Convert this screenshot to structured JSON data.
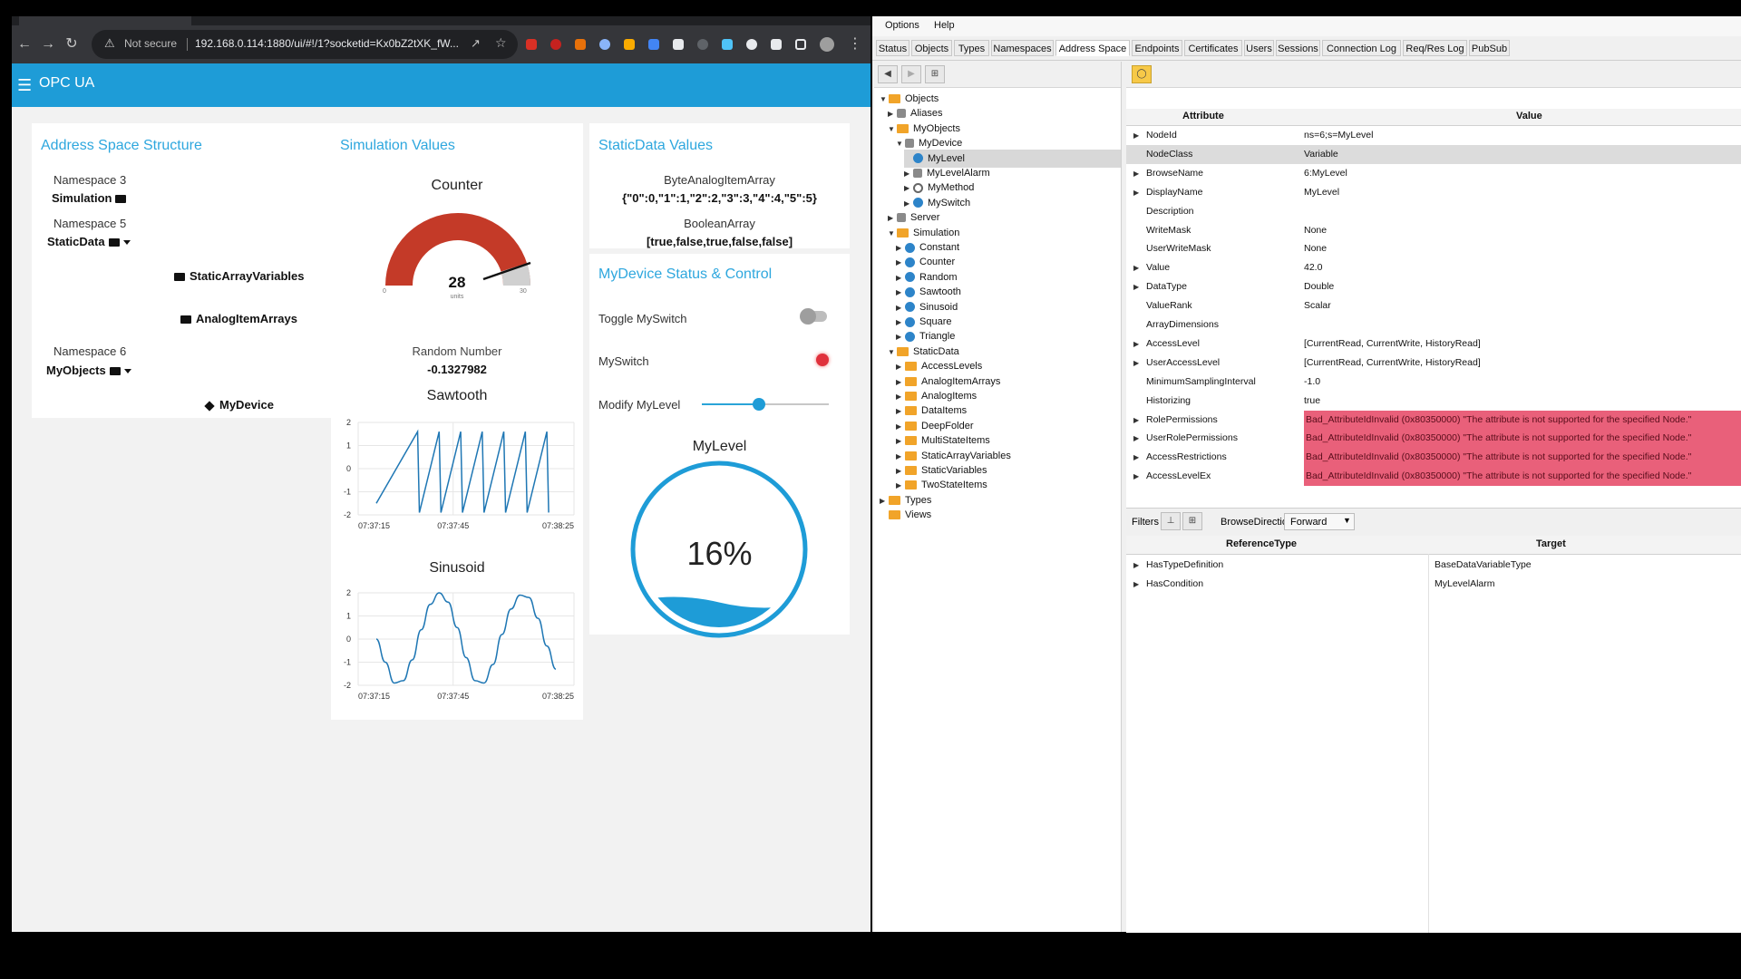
{
  "browser": {
    "security": "Not secure",
    "url": "192.168.0.114:1880/ui/#!/1?socketid=Kx0bZ2tXK_fW..."
  },
  "dashboard": {
    "app_title": "OPC UA",
    "address_space": {
      "title": "Address Space Structure",
      "ns3": "Namespace 3",
      "simulation": "Simulation",
      "ns5": "Namespace 5",
      "staticdata": "StaticData",
      "static_array_variables": "StaticArrayVariables",
      "analog_item_arrays": "AnalogItemArrays",
      "ns6": "Namespace 6",
      "myobjects": "MyObjects",
      "mydevice": "MyDevice"
    },
    "simulation": {
      "title": "Simulation Values",
      "counter_label": "Counter",
      "counter_value": "28",
      "counter_units": "units",
      "counter_min": "0",
      "counter_max": "30",
      "random_label": "Random Number",
      "random_value": "-0.1327982"
    },
    "static_data": {
      "title": "StaticData Values",
      "byte_label": "ByteAnalogItemArray",
      "byte_value": "{\"0\":0,\"1\":1,\"2\":2,\"3\":3,\"4\":4,\"5\":5}",
      "bool_label": "BooleanArray",
      "bool_value": "[true,false,true,false,false]"
    },
    "device": {
      "title": "MyDevice Status & Control",
      "toggle_label": "Toggle MySwitch",
      "switch_label": "MySwitch",
      "modify_label": "Modify MyLevel",
      "slider_fraction": 0.45,
      "mylevel_title": "MyLevel",
      "mylevel_value": "16%",
      "mylevel_fraction": 0.16
    }
  },
  "chart_data": [
    {
      "type": "line",
      "title": "Sawtooth",
      "ylim": [
        -2,
        2
      ],
      "yticks": [
        "2",
        "1",
        "0",
        "-1",
        "-2"
      ],
      "xticks": [
        "07:37:15",
        "07:37:45",
        "07:38:25"
      ],
      "x": [
        0,
        0.23,
        0.24,
        0.35,
        0.36,
        0.47,
        0.48,
        0.59,
        0.6,
        0.71,
        0.72,
        0.83,
        0.84,
        0.95,
        0.96
      ],
      "values": [
        -1.5,
        1.6,
        -1.9,
        1.6,
        -1.9,
        1.6,
        -1.9,
        1.6,
        -1.9,
        1.6,
        -1.9,
        1.6,
        -1.9,
        1.6,
        -1.9
      ]
    },
    {
      "type": "line",
      "title": "Sinusoid",
      "ylim": [
        -2,
        2
      ],
      "yticks": [
        "2",
        "1",
        "0",
        "-1",
        "-2"
      ],
      "xticks": [
        "07:37:15",
        "07:37:45",
        "07:38:25"
      ],
      "x": [
        0,
        0.05,
        0.1,
        0.15,
        0.2,
        0.25,
        0.3,
        0.35,
        0.4,
        0.45,
        0.5,
        0.55,
        0.6,
        0.65,
        0.7,
        0.75,
        0.8,
        0.85,
        0.9,
        0.95,
        1.0
      ],
      "values": [
        0.0,
        -1.0,
        -1.9,
        -1.8,
        -0.9,
        0.4,
        1.5,
        2.0,
        1.6,
        0.5,
        -0.8,
        -1.8,
        -1.9,
        -1.1,
        0.2,
        1.3,
        1.9,
        1.8,
        0.9,
        -0.3,
        -1.3
      ]
    }
  ],
  "app": {
    "menu": [
      "Options",
      "Help"
    ],
    "tabs": [
      "Status",
      "Objects",
      "Types",
      "Namespaces",
      "Address Space",
      "Endpoints",
      "Certificates",
      "Users",
      "Sessions",
      "Connection Log",
      "Req/Res Log",
      "PubSub"
    ],
    "tree": [
      {
        "label": "Objects",
        "icon": "folder",
        "arrow": "▼"
      },
      {
        "label": "Aliases",
        "icon": "object",
        "arrow": "▶"
      },
      {
        "label": "MyObjects",
        "icon": "folder",
        "arrow": "▼"
      },
      {
        "label": "MyDevice",
        "icon": "object",
        "arrow": "▼"
      },
      {
        "label": "MyLevel",
        "icon": "variable",
        "arrow": ""
      },
      {
        "label": "MyLevelAlarm",
        "icon": "object",
        "arrow": "▶"
      },
      {
        "label": "MyMethod",
        "icon": "gear",
        "arrow": "▶"
      },
      {
        "label": "MySwitch",
        "icon": "variable",
        "arrow": "▶"
      },
      {
        "label": "Server",
        "icon": "object",
        "arrow": "▶"
      },
      {
        "label": "Simulation",
        "icon": "folder",
        "arrow": "▼"
      },
      {
        "label": "Constant",
        "icon": "variable",
        "arrow": "▶"
      },
      {
        "label": "Counter",
        "icon": "variable",
        "arrow": "▶"
      },
      {
        "label": "Random",
        "icon": "variable",
        "arrow": "▶"
      },
      {
        "label": "Sawtooth",
        "icon": "variable",
        "arrow": "▶"
      },
      {
        "label": "Sinusoid",
        "icon": "variable",
        "arrow": "▶"
      },
      {
        "label": "Square",
        "icon": "variable",
        "arrow": "▶"
      },
      {
        "label": "Triangle",
        "icon": "variable",
        "arrow": "▶"
      },
      {
        "label": "StaticData",
        "icon": "folder",
        "arrow": "▼"
      },
      {
        "label": "AccessLevels",
        "icon": "folder",
        "arrow": "▶"
      },
      {
        "label": "AnalogItemArrays",
        "icon": "folder",
        "arrow": "▶"
      },
      {
        "label": "AnalogItems",
        "icon": "folder",
        "arrow": "▶"
      },
      {
        "label": "DataItems",
        "icon": "folder",
        "arrow": "▶"
      },
      {
        "label": "DeepFolder",
        "icon": "folder",
        "arrow": "▶"
      },
      {
        "label": "MultiStateItems",
        "icon": "folder",
        "arrow": "▶"
      },
      {
        "label": "StaticArrayVariables",
        "icon": "folder",
        "arrow": "▶"
      },
      {
        "label": "StaticVariables",
        "icon": "folder",
        "arrow": "▶"
      },
      {
        "label": "TwoStateItems",
        "icon": "folder",
        "arrow": "▶"
      },
      {
        "label": "Types",
        "icon": "folder",
        "arrow": "▶"
      },
      {
        "label": "Views",
        "icon": "folder",
        "arrow": ""
      }
    ],
    "attr_headers": {
      "attribute": "Attribute",
      "value": "Value"
    },
    "attributes": [
      {
        "name": "NodeId",
        "value": "ns=6;s=MyLevel",
        "arrow": "▶"
      },
      {
        "name": "NodeClass",
        "value": "Variable",
        "arrow": ""
      },
      {
        "name": "BrowseName",
        "value": "6:MyLevel",
        "arrow": "▶"
      },
      {
        "name": "DisplayName",
        "value": "MyLevel",
        "arrow": "▶"
      },
      {
        "name": "Description",
        "value": "",
        "arrow": ""
      },
      {
        "name": "WriteMask",
        "value": "None",
        "arrow": ""
      },
      {
        "name": "UserWriteMask",
        "value": "None",
        "arrow": ""
      },
      {
        "name": "Value",
        "value": "42.0",
        "arrow": "▶"
      },
      {
        "name": "DataType",
        "value": "Double",
        "arrow": "▶"
      },
      {
        "name": "ValueRank",
        "value": "Scalar",
        "arrow": ""
      },
      {
        "name": "ArrayDimensions",
        "value": "",
        "arrow": ""
      },
      {
        "name": "AccessLevel",
        "value": "[CurrentRead, CurrentWrite, HistoryRead]",
        "arrow": "▶"
      },
      {
        "name": "UserAccessLevel",
        "value": "[CurrentRead, CurrentWrite, HistoryRead]",
        "arrow": "▶"
      },
      {
        "name": "MinimumSamplingInterval",
        "value": "-1.0",
        "arrow": ""
      },
      {
        "name": "Historizing",
        "value": "true",
        "arrow": ""
      },
      {
        "name": "RolePermissions",
        "value": "Bad_AttributeIdInvalid (0x80350000) \"The attribute is not supported for the specified Node.\"",
        "arrow": "▶"
      },
      {
        "name": "UserRolePermissions",
        "value": "Bad_AttributeIdInvalid (0x80350000) \"The attribute is not supported for the specified Node.\"",
        "arrow": "▶"
      },
      {
        "name": "AccessRestrictions",
        "value": "Bad_AttributeIdInvalid (0x80350000) \"The attribute is not supported for the specified Node.\"",
        "arrow": "▶"
      },
      {
        "name": "AccessLevelEx",
        "value": "Bad_AttributeIdInvalid (0x80350000) \"The attribute is not supported for the specified Node.\"",
        "arrow": "▶"
      }
    ],
    "filters_label": "Filters",
    "browse_direction_label": "BrowseDirection",
    "browse_direction_value": "Forward",
    "ref_headers": {
      "type": "ReferenceType",
      "target": "Target"
    },
    "references": [
      {
        "type": "HasTypeDefinition",
        "target": "BaseDataVariableType"
      },
      {
        "type": "HasCondition",
        "target": "MyLevelAlarm"
      }
    ],
    "colors": {
      "accent": "#1e9cd7",
      "error": "#e9607a",
      "folder": "#f1a429",
      "variable": "#2d84c9"
    }
  }
}
